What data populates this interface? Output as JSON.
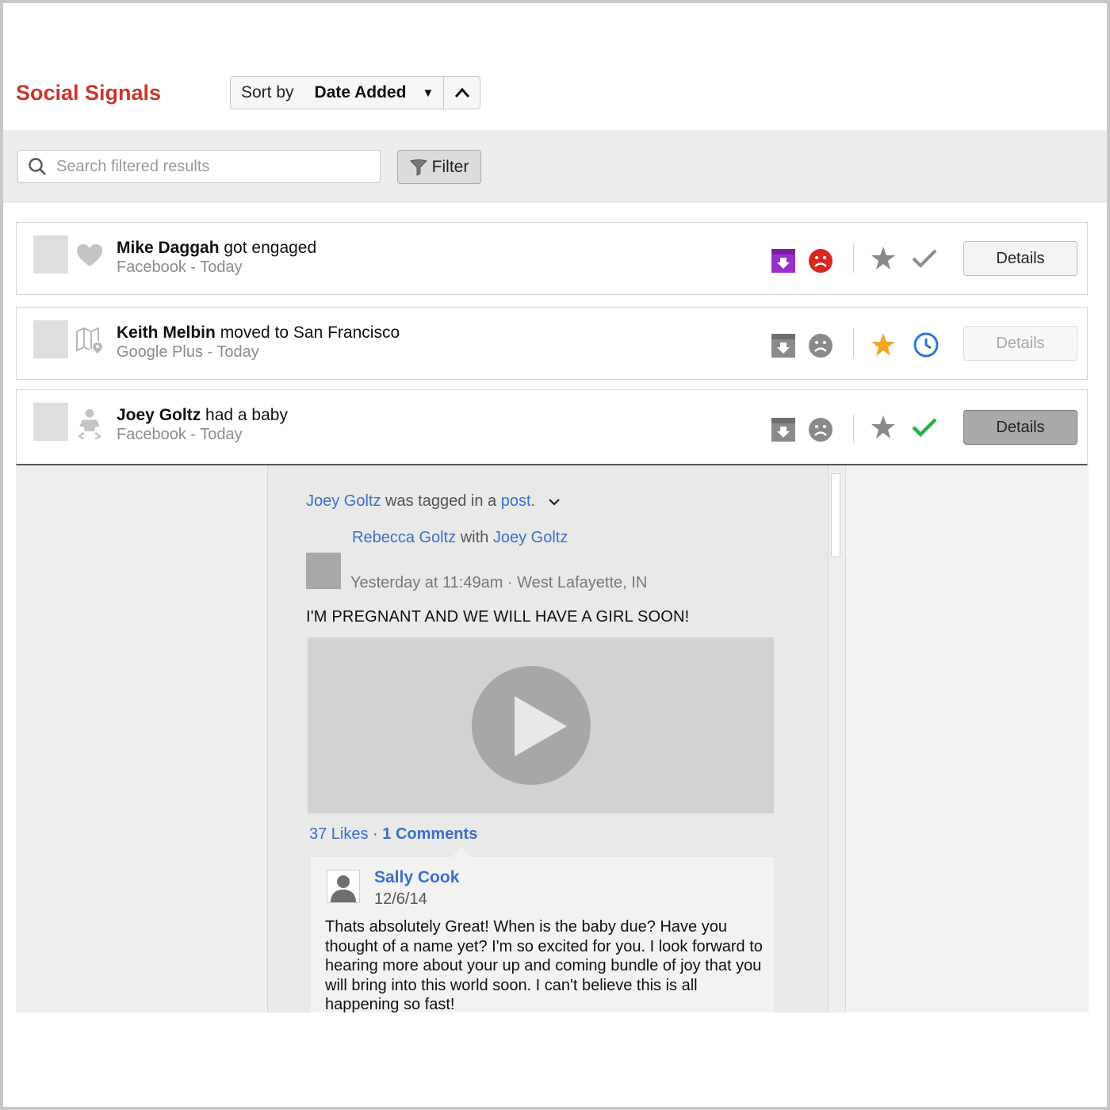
{
  "header": {
    "title": "Social Signals",
    "sort_label": "Sort by",
    "sort_value": "Date Added"
  },
  "toolbar": {
    "search_placeholder": "Search filtered results",
    "filter_label": "Filter"
  },
  "signals": [
    {
      "name": "Mike Daggah",
      "event": "got engaged",
      "source": "Facebook - Today",
      "type_icon": "heart-icon",
      "details_label": "Details",
      "details_state": "normal",
      "colors": {
        "archive": "#9b2fc9",
        "sad": "#d7281f",
        "star": "#8a8a8a",
        "status": "#8a8a8a"
      },
      "status_icon": "check-icon"
    },
    {
      "name": "Keith Melbin",
      "event": "moved to San Francisco",
      "source": "Google Plus - Today",
      "type_icon": "map-pin-icon",
      "details_label": "Details",
      "details_state": "disabled",
      "colors": {
        "archive": "#8a8a8a",
        "sad": "#8a8a8a",
        "star": "#f0a623",
        "status": "#2e73d8"
      },
      "status_icon": "clock-icon"
    },
    {
      "name": "Joey Goltz",
      "event": "had a baby",
      "source": "Facebook - Today",
      "type_icon": "baby-icon",
      "details_label": "Details",
      "details_state": "active",
      "colors": {
        "archive": "#8a8a8a",
        "sad": "#8a8a8a",
        "star": "#8a8a8a",
        "status": "#2fae4e"
      },
      "status_icon": "check-icon"
    }
  ],
  "post": {
    "tagged_name": "Joey Goltz",
    "tagged_mid": "was tagged in a",
    "tagged_link": "post",
    "tagged_end": ".",
    "author": "Rebecca Goltz",
    "with_word": "with",
    "with_name": "Joey Goltz",
    "meta": "Yesterday at 11:49am · West Lafayette, IN",
    "text": "I'M PREGNANT AND WE WILL HAVE A GIRL SOON!",
    "likes": "37 Likes",
    "stats_sep": " · ",
    "comments": "1 Comments",
    "comment": {
      "name": "Sally Cook",
      "date": "12/6/14",
      "body": "Thats absolutely Great! When is the baby due? Have you thought of a name yet? I'm so excited for you. I look forward to hearing more about your up and coming bundle of joy that you will bring into this world soon. I can't believe this is all happening so fast!"
    }
  },
  "colors": {
    "brand": "#c9372c",
    "link": "#3b6fc9"
  }
}
